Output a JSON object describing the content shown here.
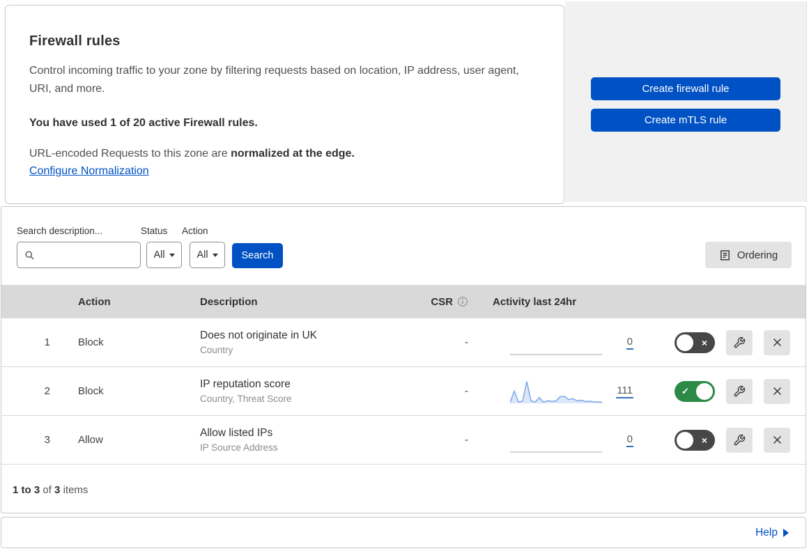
{
  "header": {
    "title": "Firewall rules",
    "description": "Control incoming traffic to your zone by filtering requests based on location, IP address, user agent, URI, and more.",
    "usage": "You have used 1 of 20 active Firewall rules.",
    "normalization_text": "URL-encoded Requests to this zone are ",
    "normalization_bold": "normalized at the edge.",
    "normalization_link": "Configure Normalization",
    "buttons": {
      "create_firewall": "Create firewall rule",
      "create_mtls": "Create mTLS rule"
    }
  },
  "filters": {
    "search_label": "Search description...",
    "search_value": "",
    "status_label": "Status",
    "status_value": "All",
    "action_label": "Action",
    "action_value": "All",
    "search_button": "Search",
    "ordering_button": "Ordering"
  },
  "table": {
    "columns": {
      "action": "Action",
      "description": "Description",
      "csr": "CSR",
      "activity": "Activity last 24hr"
    },
    "rows": [
      {
        "index": "1",
        "action": "Block",
        "description": "Does not originate in UK",
        "fields": "Country",
        "csr": "-",
        "activity_count": "0",
        "enabled": false,
        "sparkline": [
          0,
          0,
          0,
          0,
          0,
          0,
          0,
          0,
          0,
          0,
          0,
          0,
          0,
          0,
          0,
          0,
          0,
          0,
          0,
          0,
          0,
          0,
          0
        ]
      },
      {
        "index": "2",
        "action": "Block",
        "description": "IP reputation score",
        "fields": "Country, Threat Score",
        "csr": "-",
        "activity_count": "111",
        "enabled": true,
        "sparkline": [
          3,
          55,
          6,
          10,
          98,
          12,
          6,
          26,
          5,
          12,
          9,
          11,
          30,
          31,
          17,
          21,
          11,
          14,
          8,
          9,
          7,
          6,
          5
        ]
      },
      {
        "index": "3",
        "action": "Allow",
        "description": "Allow listed IPs",
        "fields": "IP Source Address",
        "csr": "-",
        "activity_count": "0",
        "enabled": false,
        "sparkline": [
          0,
          0,
          0,
          0,
          0,
          0,
          0,
          0,
          0,
          0,
          0,
          0,
          0,
          0,
          0,
          0,
          0,
          0,
          0,
          0,
          0,
          0,
          0
        ]
      }
    ],
    "footer": {
      "range": "1 to 3",
      "of": "of",
      "total": "3",
      "items": "items"
    }
  },
  "help": {
    "label": "Help"
  },
  "icons": {
    "toggle_off_x": "×",
    "toggle_on_check": "✓"
  },
  "colors": {
    "accent_blue": "#0051c3",
    "toggle_on_green": "#2d8a46",
    "toggle_off_gray": "#474747",
    "sparkline_line": "#7da7ea",
    "sparkline_fill": "#dce7f8",
    "sparkline_flat": "#c6c6c6",
    "table_header_bg": "#d9d9d9",
    "panel_gray": "#f1f1f1"
  }
}
